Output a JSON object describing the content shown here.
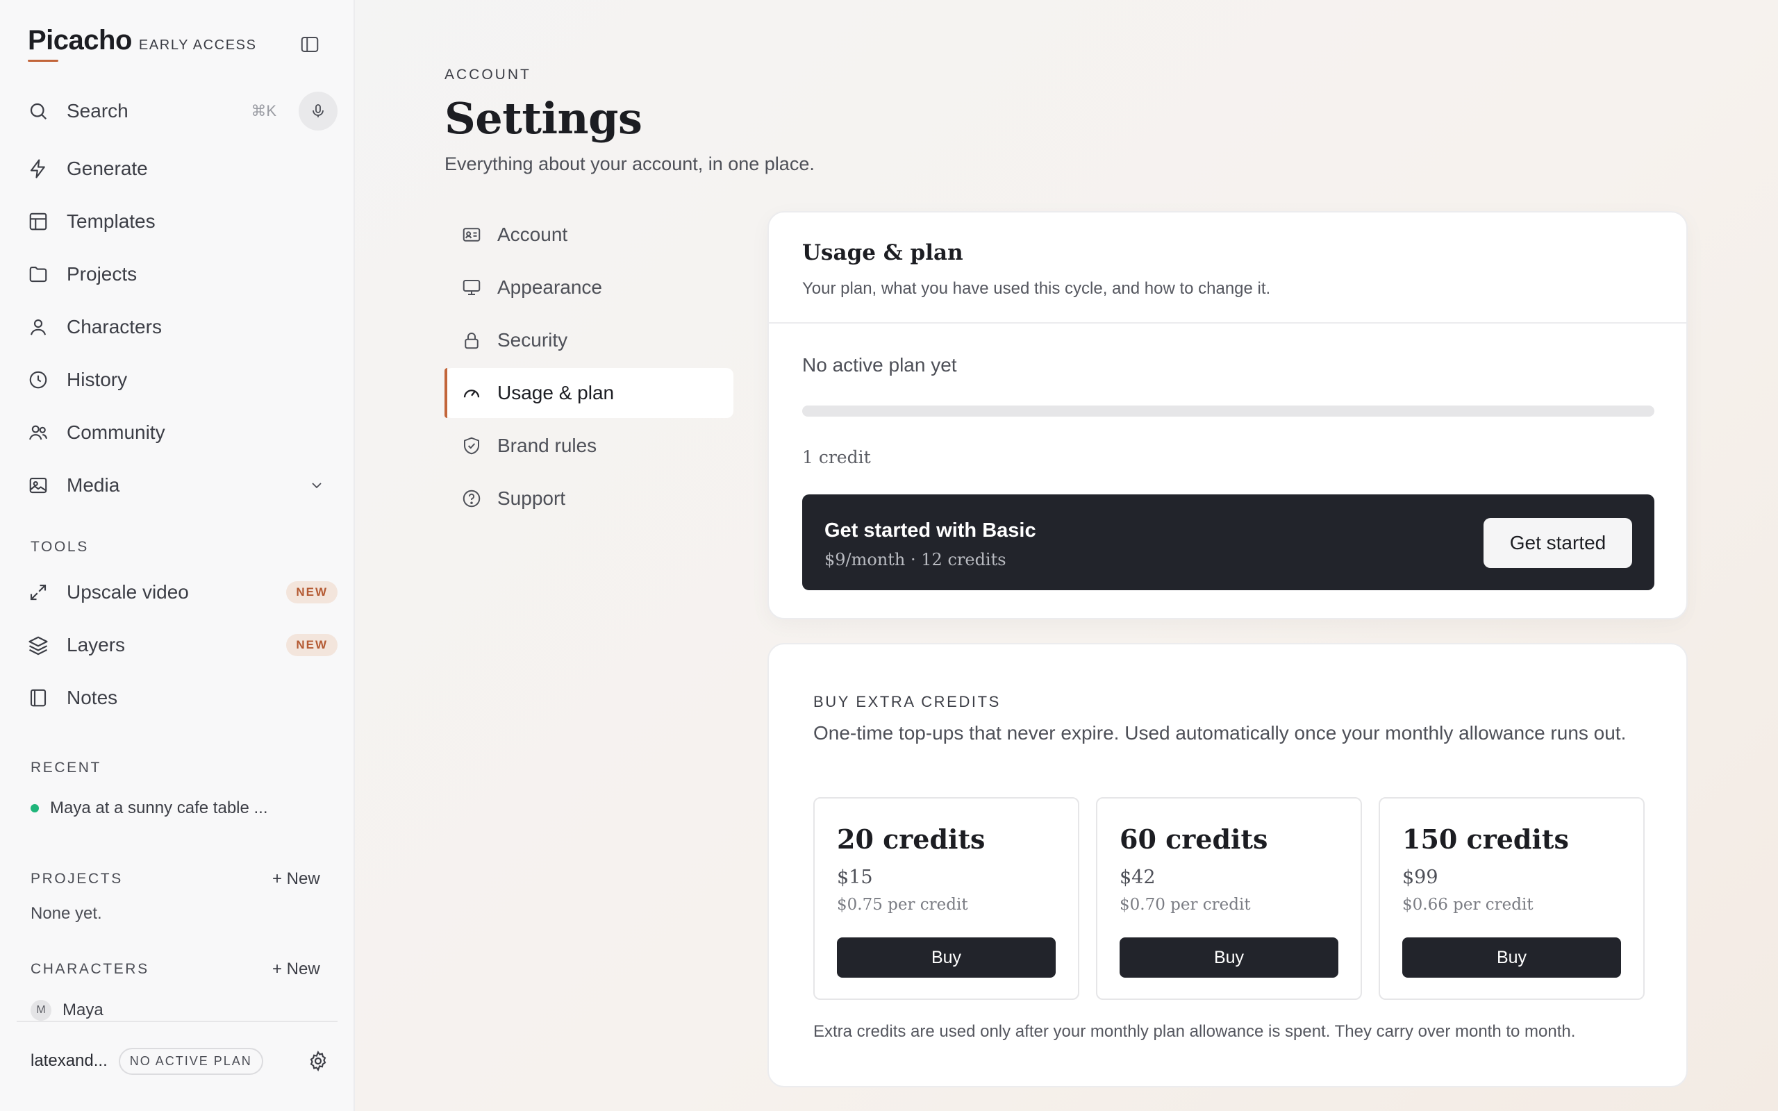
{
  "app": {
    "name": "Picacho",
    "tag": "EARLY ACCESS",
    "accent_color": "#c2653a"
  },
  "search": {
    "label": "Search",
    "shortcut": "⌘K"
  },
  "sidebar": {
    "items": [
      {
        "label": "Generate",
        "icon": "lightning-icon"
      },
      {
        "label": "Templates",
        "icon": "layout-icon"
      },
      {
        "label": "Projects",
        "icon": "folder-icon"
      },
      {
        "label": "Characters",
        "icon": "person-icon"
      },
      {
        "label": "History",
        "icon": "clock-icon"
      },
      {
        "label": "Community",
        "icon": "people-icon"
      },
      {
        "label": "Media",
        "icon": "image-icon"
      }
    ],
    "tools_label": "TOOLS",
    "tools": [
      {
        "label": "Upscale video",
        "icon": "expand-icon",
        "badge": "NEW"
      },
      {
        "label": "Layers",
        "icon": "layers-icon",
        "badge": "NEW"
      },
      {
        "label": "Notes",
        "icon": "notebook-icon",
        "badge": ""
      }
    ],
    "recent_label": "RECENT",
    "recent": [
      {
        "label": "Maya at a sunny cafe table ..."
      }
    ],
    "projects_label": "PROJECTS",
    "projects_new": "+ New",
    "projects_empty": "None yet.",
    "characters_label": "CHARACTERS",
    "characters_new": "+ New",
    "characters": [
      {
        "initial": "M",
        "name": "Maya"
      }
    ],
    "footer": {
      "user": "latexand...",
      "plan_chip": "NO ACTIVE PLAN"
    }
  },
  "header": {
    "eyebrow": "ACCOUNT",
    "title": "Settings",
    "subtitle": "Everything about your account, in one place."
  },
  "settings_nav": [
    {
      "label": "Account",
      "icon": "id-card-icon",
      "active": false
    },
    {
      "label": "Appearance",
      "icon": "monitor-icon",
      "active": false
    },
    {
      "label": "Security",
      "icon": "lock-icon",
      "active": false
    },
    {
      "label": "Usage & plan",
      "icon": "gauge-icon",
      "active": true
    },
    {
      "label": "Brand rules",
      "icon": "shield-check-icon",
      "active": false
    },
    {
      "label": "Support",
      "icon": "help-circle-icon",
      "active": false
    }
  ],
  "usage": {
    "title": "Usage & plan",
    "subtitle": "Your plan, what you have used this cycle, and how to change it.",
    "status": "No active plan yet",
    "progress_fraction": 0,
    "credits": "1 credit",
    "promo": {
      "title": "Get started with Basic",
      "subtitle": "$9/month · 12 credits",
      "button": "Get started"
    }
  },
  "extra": {
    "eyebrow": "BUY EXTRA CREDITS",
    "description": "One-time top-ups that never expire. Used automatically once your monthly allowance runs out.",
    "packs": [
      {
        "title": "20 credits",
        "price": "$15",
        "unit": "$0.75 per credit",
        "button": "Buy"
      },
      {
        "title": "60 credits",
        "price": "$42",
        "unit": "$0.70 per credit",
        "button": "Buy"
      },
      {
        "title": "150 credits",
        "price": "$99",
        "unit": "$0.66 per credit",
        "button": "Buy"
      }
    ],
    "footnote": "Extra credits are used only after your monthly plan allowance is spent. They carry over month to month."
  }
}
